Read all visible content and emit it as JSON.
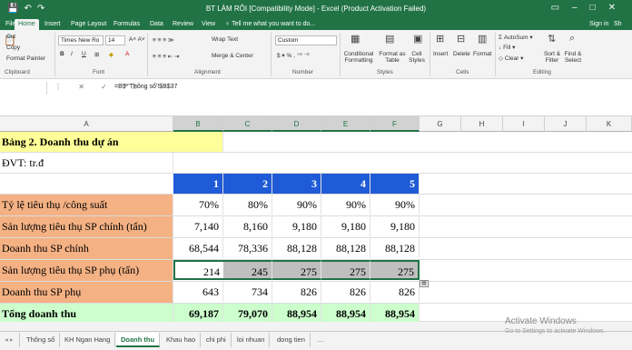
{
  "title_bar": {
    "title": "BT LÀM RÔI [Compatibility Mode] - Excel (Product Activation Failed)",
    "save_icon": "save-icon",
    "undo_icon": "undo-icon",
    "redo_icon": "redo-icon"
  },
  "tabs": [
    "File",
    "Home",
    "Insert",
    "Page Layout",
    "Formulas",
    "Data",
    "Review",
    "View",
    "♀ Tell me what you want to do...",
    "Sign in",
    "Sh"
  ],
  "ribbon": {
    "cut": "Cut",
    "copy": "Copy",
    "format_painter": "Format Painter",
    "clipboard": "Clipboard",
    "font_name": "Times New Ro",
    "font_size": "14",
    "font": "Font",
    "wrap_text": "Wrap Text",
    "merge_center": "Merge & Center",
    "alignment": "Alignment",
    "number_format": "Custom",
    "number": "Number",
    "conditional_formatting": "Conditional Formatting",
    "format_as_table": "Format as Table",
    "cell_styles": "Cell Styles",
    "styles": "Styles",
    "insert": "Insert",
    "delete": "Delete",
    "format": "Format",
    "cells": "Cells",
    "autosum": "AutoSum",
    "fill": "Fill",
    "clear": "Clear",
    "sort_filter": "Sort & Filter",
    "find_select": "Find & Select",
    "editing": "Editing"
  },
  "formula_bar": {
    "fx": "fx",
    "formula": "=B5*'Thông số'!$B$37"
  },
  "columns": [
    "A",
    "B",
    "C",
    "D",
    "E",
    "F",
    "G",
    "H",
    "I",
    "J",
    "K"
  ],
  "rows": {
    "r1": "Bảng 2. Doanh thu dự án",
    "r2": "ĐVT: tr.đ",
    "r3": [
      "1",
      "2",
      "3",
      "4",
      "5"
    ],
    "r4": {
      "label": "Tỷ lệ tiêu thụ /công suất",
      "values": [
        "70%",
        "80%",
        "90%",
        "90%",
        "90%"
      ]
    },
    "r5": {
      "label": "Sản lượng tiêu thụ SP chính (tấn)",
      "values": [
        "7,140",
        "8,160",
        "9,180",
        "9,180",
        "9,180"
      ]
    },
    "r6": {
      "label": "Doanh thu SP chính",
      "values": [
        "68,544",
        "78,336",
        "88,128",
        "88,128",
        "88,128"
      ]
    },
    "r7": {
      "label": "Sản lượng tiêu thụ SP phụ (tấn)",
      "values": [
        "214",
        "245",
        "275",
        "275",
        "275"
      ]
    },
    "r8": {
      "label": "Doanh thu SP phụ",
      "values": [
        "643",
        "734",
        "826",
        "826",
        "826"
      ]
    },
    "r9": {
      "label": "Tổng doanh thu",
      "values": [
        "69,187",
        "79,070",
        "88,954",
        "88,954",
        "88,954"
      ]
    }
  },
  "sheet_tabs": [
    "Thông số",
    "KH Ngan Hang",
    "Doanh thu",
    "Khau hao",
    "chi phi",
    "loi nhuan",
    "dong tien"
  ],
  "watermark": {
    "line1": "Activate Windows",
    "line2": "Go to Settings to activate Windows."
  }
}
